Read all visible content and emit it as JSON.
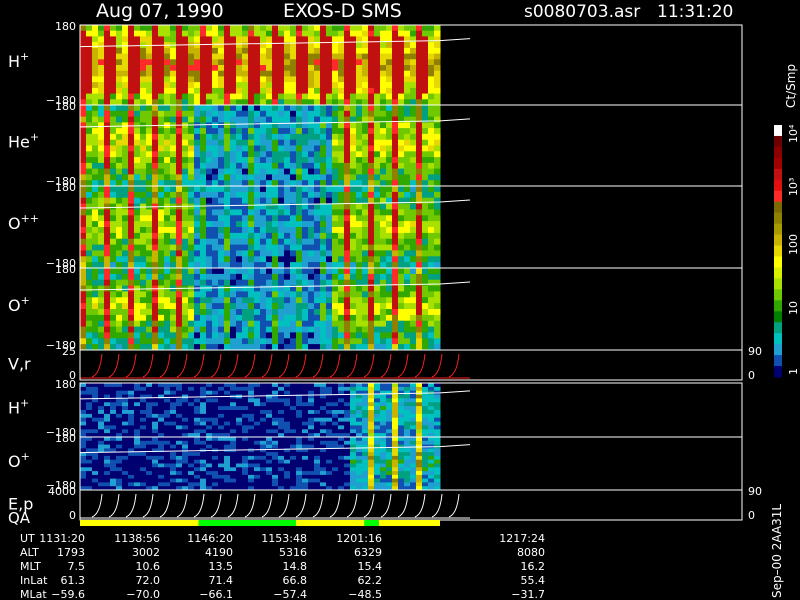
{
  "header": {
    "date": "Aug 07, 1990",
    "instrument": "EXOS-D SMS",
    "filename": "s0080703.asr",
    "time": "11:31:20"
  },
  "chart_data": {
    "type": "heatmap",
    "panels": [
      {
        "id": "h-plus",
        "label": "H",
        "sup": "+",
        "ymax": "180",
        "ymin": "−180",
        "kind": "spectrogram"
      },
      {
        "id": "he-plus",
        "label": "He",
        "sup": "+",
        "ymax": "180",
        "ymin": "−180",
        "kind": "spectrogram"
      },
      {
        "id": "o-plus-plus",
        "label": "O",
        "sup": "++",
        "ymax": "180",
        "ymin": "−180",
        "kind": "spectrogram"
      },
      {
        "id": "o-plus",
        "label": "O",
        "sup": "+",
        "ymax": "180",
        "ymin": "−180",
        "kind": "spectrogram"
      },
      {
        "id": "vr",
        "label": "V,r",
        "sup": "",
        "ymax": "25",
        "ymin": "0",
        "right_top": "90",
        "right_bottom": "0",
        "kind": "line"
      },
      {
        "id": "h-plus-2",
        "label": "H",
        "sup": "+",
        "ymax": "180",
        "ymin": "−180",
        "kind": "spectrogram"
      },
      {
        "id": "o-plus-2",
        "label": "O",
        "sup": "+",
        "ymax": "180",
        "ymin": "−180",
        "kind": "spectrogram"
      },
      {
        "id": "ep-qa",
        "label": "E,p",
        "label2": "QA",
        "sup": "",
        "ymax": "4000",
        "ymin": "0",
        "right_top": "90",
        "right_bottom": "0",
        "kind": "line"
      }
    ],
    "colorbar": {
      "title": "Ct/Smp",
      "tick_labels": [
        "10⁴",
        "10³",
        "100",
        "10",
        "1"
      ],
      "colors": [
        "#ffffff",
        "#6b0000",
        "#8b0000",
        "#a00000",
        "#c01010",
        "#e01010",
        "#ff2a2a",
        "#7a6a00",
        "#8f8000",
        "#a89a00",
        "#c8b400",
        "#e6d800",
        "#ffff00",
        "#d8f000",
        "#a8e000",
        "#70c800",
        "#30a800",
        "#008000",
        "#00a080",
        "#00c0c0",
        "#20a0d0",
        "#1050b0",
        "#000070"
      ]
    },
    "quality_bar": [
      {
        "color": "#ffff00",
        "to": 0.33
      },
      {
        "color": "#00ff00",
        "to": 0.6
      },
      {
        "color": "#ffff00",
        "to": 0.79
      },
      {
        "color": "#00ff00",
        "to": 0.83
      },
      {
        "color": "#ffff00",
        "to": 1.0
      }
    ],
    "ephemeris": {
      "row_labels": [
        "UT",
        "ALT",
        "MLT",
        "InLat",
        "MLat"
      ],
      "columns": [
        {
          "values": [
            "1131:20",
            "1793",
            "7.5",
            "61.3",
            "−59.6"
          ]
        },
        {
          "values": [
            "1138:56",
            "3002",
            "10.6",
            "72.0",
            "−70.0"
          ]
        },
        {
          "values": [
            "1146:20",
            "4190",
            "13.5",
            "71.4",
            "−66.1"
          ]
        },
        {
          "values": [
            "1153:48",
            "5316",
            "14.8",
            "66.8",
            "−57.4"
          ]
        },
        {
          "values": [
            "1201:16",
            "6329",
            "15.4",
            "62.2",
            "−48.5"
          ]
        },
        {
          "values": [
            "1217:24",
            "8080",
            "16.2",
            "55.4",
            "−31.7"
          ]
        }
      ]
    },
    "footer_stamp": "Sep–00  2AA31L"
  }
}
